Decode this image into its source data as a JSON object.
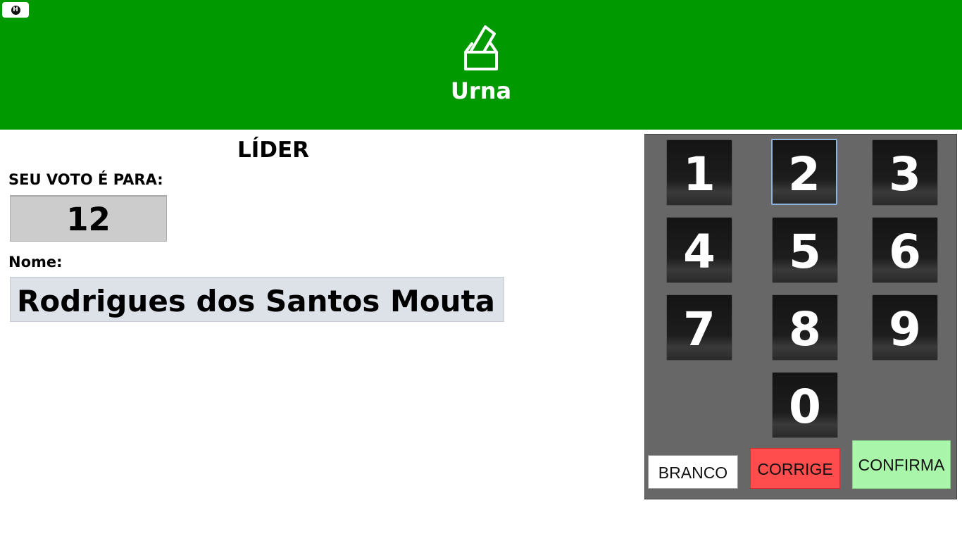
{
  "header": {
    "title": "Urna",
    "background_color": "#009900",
    "icon": "ballot-box-icon",
    "corner_button_glyph": "H"
  },
  "ballot": {
    "role": "LÍDER",
    "vote_label": "SEU VOTO É PARA:",
    "vote_number": "12",
    "name_label": "Nome:",
    "candidate_name": "Rodrigues dos Santos Mouta"
  },
  "keypad": {
    "keys": [
      "1",
      "2",
      "3",
      "4",
      "5",
      "6",
      "7",
      "8",
      "9",
      "0"
    ],
    "focused_key": "2",
    "actions": {
      "branco": "BRANCO",
      "corrige": "CORRIGE",
      "confirma": "CONFIRMA"
    },
    "colors": {
      "panel": "#676767",
      "branco": "#ffffff",
      "corrige": "#ff4d4d",
      "confirma": "#a9f5a9"
    }
  }
}
